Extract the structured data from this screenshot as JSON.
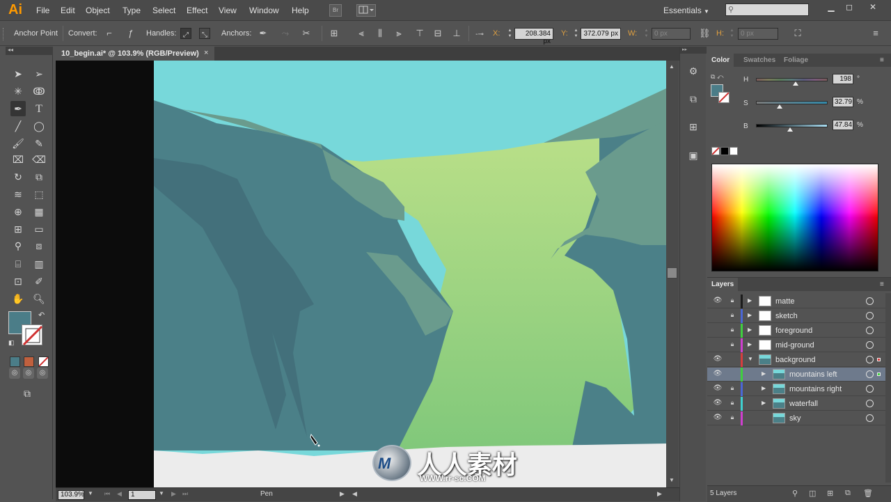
{
  "app": {
    "logo": "Ai"
  },
  "menu": [
    "File",
    "Edit",
    "Object",
    "Type",
    "Select",
    "Effect",
    "View",
    "Window",
    "Help"
  ],
  "menubar": {
    "bridge_label": "Br",
    "workspace": "Essentials"
  },
  "control": {
    "tool_name": "Anchor Point",
    "convert_label": "Convert:",
    "handles_label": "Handles:",
    "anchors_label": "Anchors:",
    "x_label": "X:",
    "x_value": "208.384 px",
    "y_label": "Y:",
    "y_value": "372.079 px",
    "w_label": "W:",
    "w_value": "0 px",
    "h_label": "H:",
    "h_value": "0 px"
  },
  "document": {
    "tab_title": "10_begin.ai* @ 103.9% (RGB/Preview)",
    "close": "×"
  },
  "status": {
    "zoom": "103.9%",
    "page": "1",
    "tool": "Pen"
  },
  "color_panel": {
    "tabs": [
      "Color",
      "Swatches",
      "Foliage"
    ],
    "h_label": "H",
    "h_value": "198",
    "h_unit": "°",
    "s_label": "S",
    "s_value": "32.79",
    "s_unit": "%",
    "b_label": "B",
    "b_value": "47.84",
    "b_unit": "%",
    "h_level": 0.55,
    "s_level": 0.328,
    "b_level": 0.478,
    "fill_color": "#4b7d88"
  },
  "layers_panel": {
    "title": "Layers",
    "count": "5 Layers",
    "layers": [
      {
        "name": "matte",
        "visible": true,
        "locked": true,
        "color": "#1c1c1c",
        "expandable": true,
        "indent": 0
      },
      {
        "name": "sketch",
        "visible": false,
        "locked": true,
        "color": "#4b67d6",
        "expandable": true,
        "indent": 0
      },
      {
        "name": "foreground",
        "visible": false,
        "locked": true,
        "color": "#3fcf3f",
        "expandable": true,
        "indent": 0
      },
      {
        "name": "mid-ground",
        "visible": false,
        "locked": true,
        "color": "#cf3fcf",
        "expandable": true,
        "indent": 0
      },
      {
        "name": "background",
        "visible": true,
        "locked": false,
        "color": "#d63e3e",
        "expandable": true,
        "expanded": true,
        "indent": 0
      },
      {
        "name": "mountains left",
        "visible": true,
        "locked": false,
        "color": "#3fcf3f",
        "expandable": true,
        "indent": 1,
        "selected": true
      },
      {
        "name": "mountains right",
        "visible": true,
        "locked": true,
        "color": "#4b67d6",
        "expandable": true,
        "indent": 1
      },
      {
        "name": "waterfall",
        "visible": true,
        "locked": true,
        "color": "#3fd0d0",
        "expandable": true,
        "indent": 1
      },
      {
        "name": "sky",
        "visible": true,
        "locked": true,
        "color": "#cf3fcf",
        "expandable": false,
        "indent": 1
      }
    ]
  },
  "watermark": {
    "main": "人人素材",
    "url": "WWW.rr-sc.COM"
  },
  "colors": {
    "sky": "#77d8da",
    "mountain": "#4b8088",
    "mountain_dark": "#43707b",
    "ridge": "#6a9b8d",
    "valley_top": "#b9df88",
    "valley_bottom": "#7ec77a",
    "snow": "#ececec"
  }
}
